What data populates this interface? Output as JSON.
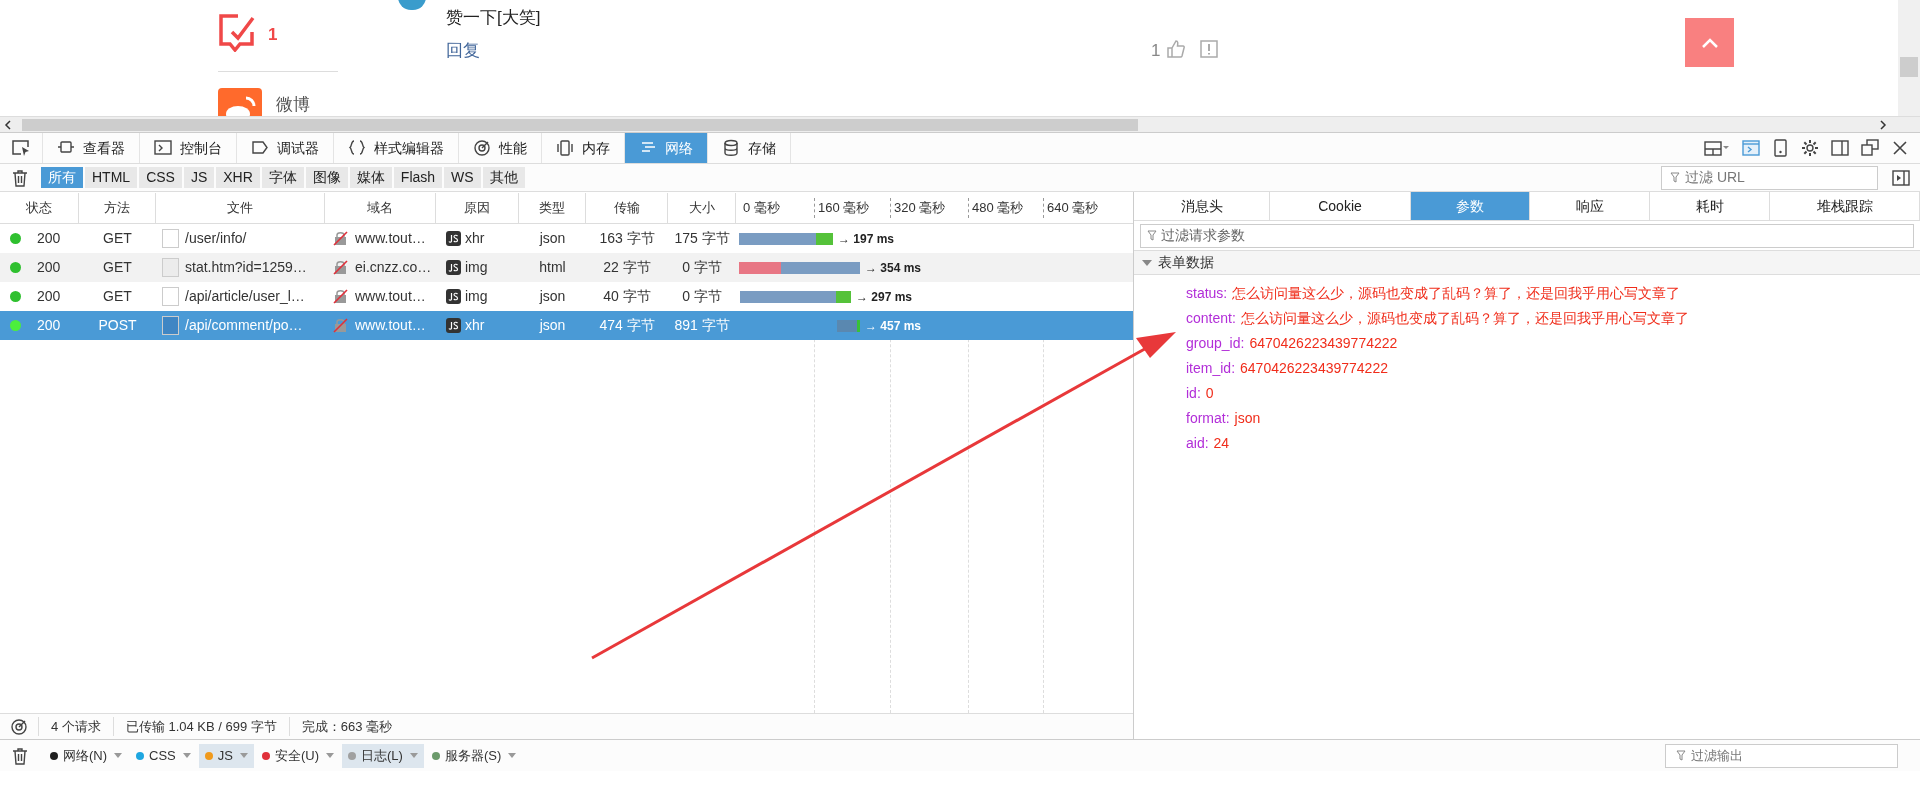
{
  "page": {
    "comment_count": "1",
    "comment_text": "赞一下[大笑]",
    "reply_link": "回复",
    "like_count": "1",
    "share_label": "微博"
  },
  "toolbar": {
    "tabs": [
      {
        "label": "查看器",
        "selected": false
      },
      {
        "label": "控制台",
        "selected": false
      },
      {
        "label": "调试器",
        "selected": false
      },
      {
        "label": "样式编辑器",
        "selected": false
      },
      {
        "label": "性能",
        "selected": false
      },
      {
        "label": "内存",
        "selected": false
      },
      {
        "label": "网络",
        "selected": true
      },
      {
        "label": "存储",
        "selected": false
      }
    ]
  },
  "filters": [
    {
      "label": "所有",
      "selected": true
    },
    {
      "label": "HTML",
      "selected": false
    },
    {
      "label": "CSS",
      "selected": false
    },
    {
      "label": "JS",
      "selected": false
    },
    {
      "label": "XHR",
      "selected": false
    },
    {
      "label": "字体",
      "selected": false
    },
    {
      "label": "图像",
      "selected": false
    },
    {
      "label": "媒体",
      "selected": false
    },
    {
      "label": "Flash",
      "selected": false
    },
    {
      "label": "WS",
      "selected": false
    },
    {
      "label": "其他",
      "selected": false
    }
  ],
  "url_filter": {
    "placeholder": "过滤 URL"
  },
  "table": {
    "columns": [
      "状态",
      "方法",
      "文件",
      "域名",
      "原因",
      "类型",
      "传输",
      "大小"
    ],
    "ticks": [
      "0 毫秒",
      "160 毫秒",
      "320 毫秒",
      "480 毫秒",
      "640 毫秒"
    ],
    "rows": [
      {
        "status": "200",
        "method": "GET",
        "file": "/user/info/",
        "domain": "www.tout…",
        "cause": "xhr",
        "type": "json",
        "transferred": "163 字节",
        "size": "175 字节",
        "timing": "→ 197 ms",
        "selected": false
      },
      {
        "status": "200",
        "method": "GET",
        "file": "stat.htm?id=1259…",
        "domain": "ei.cnzz.co…",
        "cause": "img",
        "type": "html",
        "transferred": "22 字节",
        "size": "0 字节",
        "timing": "→ 354 ms",
        "selected": false
      },
      {
        "status": "200",
        "method": "GET",
        "file": "/api/article/user_l…",
        "domain": "www.tout…",
        "cause": "img",
        "type": "json",
        "transferred": "40 字节",
        "size": "0 字节",
        "timing": "→ 297 ms",
        "selected": false
      },
      {
        "status": "200",
        "method": "POST",
        "file": "/api/comment/po…",
        "domain": "www.tout…",
        "cause": "xhr",
        "type": "json",
        "transferred": "474 字节",
        "size": "891 字节",
        "timing": "→ 457 ms",
        "selected": true
      }
    ]
  },
  "summary": {
    "requests": "4 个请求",
    "transferred": "已传输 1.04 KB / 699 字节",
    "finished": "完成：663 毫秒"
  },
  "details": {
    "tabs": [
      {
        "label": "消息头",
        "selected": false
      },
      {
        "label": "Cookie",
        "selected": false
      },
      {
        "label": "参数",
        "selected": true
      },
      {
        "label": "响应",
        "selected": false
      },
      {
        "label": "耗时",
        "selected": false
      },
      {
        "label": "堆栈跟踪",
        "selected": false
      }
    ],
    "filter": {
      "placeholder": "过滤请求参数"
    },
    "section": {
      "title": "表单数据",
      "expanded": true
    },
    "params": [
      {
        "key": "status:",
        "value": "怎么访问量这么少，源码也变成了乱码？算了，还是回我乎用心写文章了"
      },
      {
        "key": "content:",
        "value": "怎么访问量这么少，源码也变成了乱码？算了，还是回我乎用心写文章了"
      },
      {
        "key": "group_id:",
        "value": "6470426223439774222"
      },
      {
        "key": "item_id:",
        "value": "6470426223439774222"
      },
      {
        "key": "id:",
        "value": "0"
      },
      {
        "key": "format:",
        "value": "json"
      },
      {
        "key": "aid:",
        "value": "24"
      }
    ]
  },
  "console_filters": [
    {
      "label": "网络(N)",
      "color": "#1f1f1f",
      "selected": false
    },
    {
      "label": "CSS",
      "color": "#1ea6e0",
      "selected": false
    },
    {
      "label": "JS",
      "color": "#f09a1d",
      "selected": true
    },
    {
      "label": "安全(U)",
      "color": "#e0303a",
      "selected": false
    },
    {
      "label": "日志(L)",
      "color": "#a0a0a0",
      "selected": true
    },
    {
      "label": "服务器(S)",
      "color": "#6b9a6b",
      "selected": false
    }
  ],
  "output_filter": {
    "placeholder": "过滤输出"
  }
}
